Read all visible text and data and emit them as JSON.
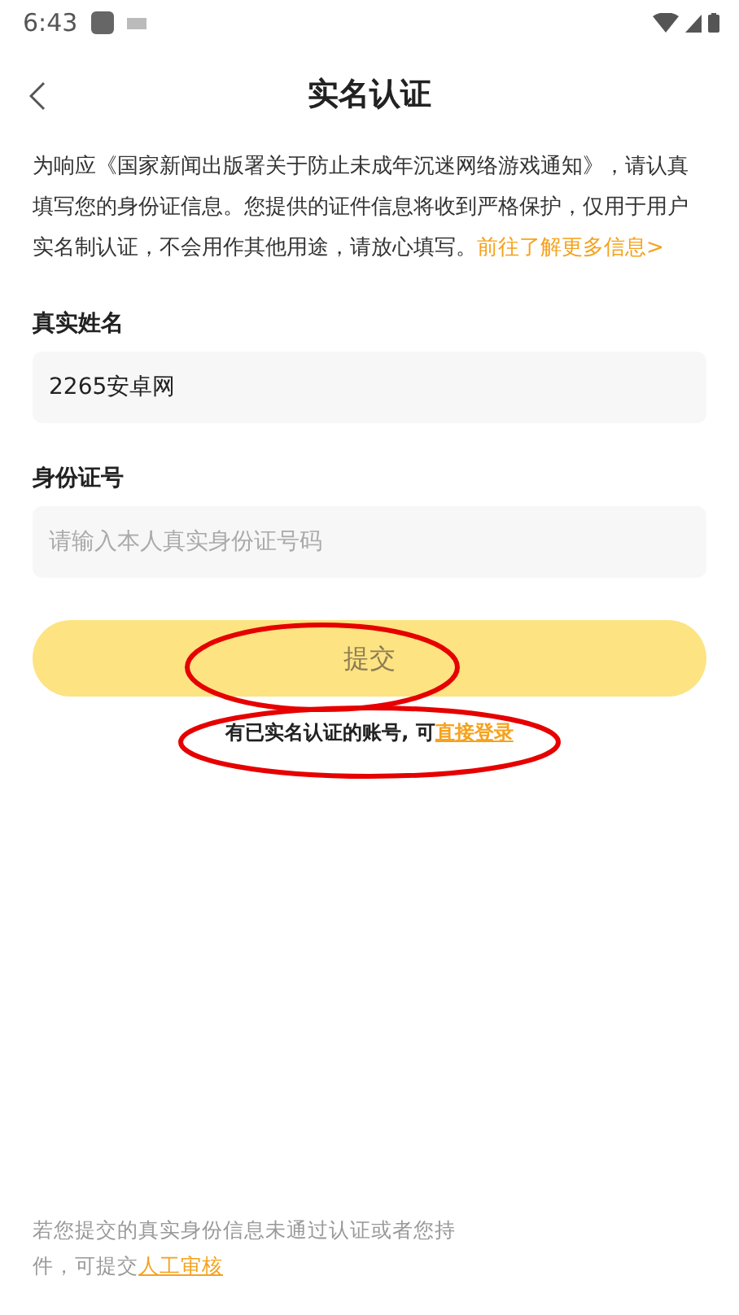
{
  "status_bar": {
    "time": "6:43"
  },
  "header": {
    "title": "实名认证"
  },
  "notice": {
    "text": "为响应《国家新闻出版署关于防止未成年沉迷网络游戏通知》，请认真填写您的身份证信息。您提供的证件信息将收到严格保护，仅用于用户实名制认证，不会用作其他用途，请放心填写。",
    "link": "前往了解更多信息>"
  },
  "fields": [
    {
      "label": "真实姓名",
      "value": "2265安卓网"
    },
    {
      "label": "身份证号",
      "placeholder": "请输入本人真实身份证号码"
    }
  ],
  "submit": {
    "label": "提交",
    "disabled": true
  },
  "login_hint": {
    "text": "有已实名认证的账号, 可",
    "link": "直接登录"
  },
  "footer": {
    "line": "若您提交的真实身份信息未通过认证或者您持",
    "text": "件，可提交",
    "link": "人工审核"
  }
}
